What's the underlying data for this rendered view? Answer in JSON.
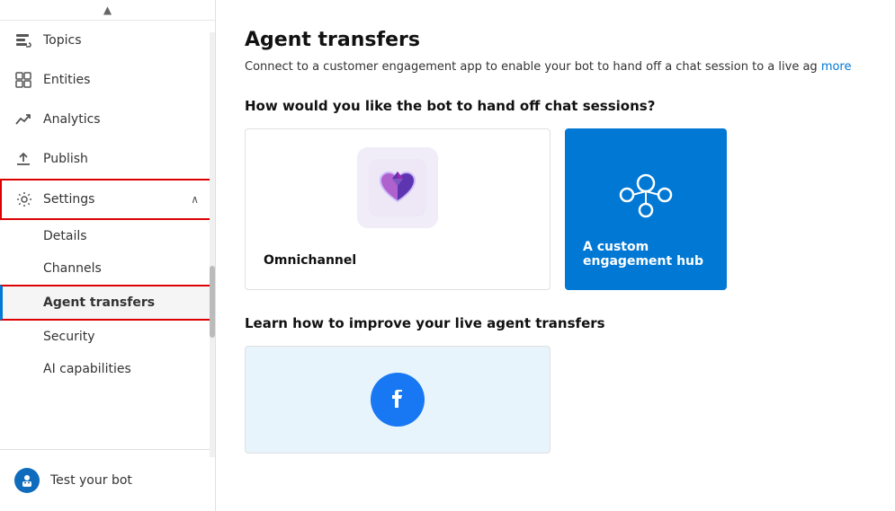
{
  "sidebar": {
    "scrollArrow": "▲",
    "items": [
      {
        "id": "topics",
        "label": "Topics",
        "icon": "comment"
      },
      {
        "id": "entities",
        "label": "Entities",
        "icon": "grid"
      },
      {
        "id": "analytics",
        "label": "Analytics",
        "icon": "trending-up"
      },
      {
        "id": "publish",
        "label": "Publish",
        "icon": "upload"
      }
    ],
    "settings": {
      "label": "Settings",
      "icon": "gear",
      "chevron": "∧",
      "subItems": [
        {
          "id": "details",
          "label": "Details"
        },
        {
          "id": "channels",
          "label": "Channels"
        },
        {
          "id": "agent-transfers",
          "label": "Agent transfers",
          "active": true
        },
        {
          "id": "security",
          "label": "Security"
        },
        {
          "id": "ai-capabilities",
          "label": "AI capabilities"
        }
      ]
    },
    "testBot": {
      "label": "Test your bot",
      "icon": "🤖"
    }
  },
  "main": {
    "title": "Agent transfers",
    "description": "Connect to a customer engagement app to enable your bot to hand off a chat session to a live ag",
    "descriptionLink": "more",
    "handoffQuestion": "How would you like the bot to hand off chat sessions?",
    "cards": [
      {
        "id": "omnichannel",
        "label": "Omnichannel"
      },
      {
        "id": "custom-hub",
        "label": "A custom engagement hub"
      }
    ],
    "learnSection": {
      "heading": "Learn how to improve your live agent transfers"
    }
  }
}
